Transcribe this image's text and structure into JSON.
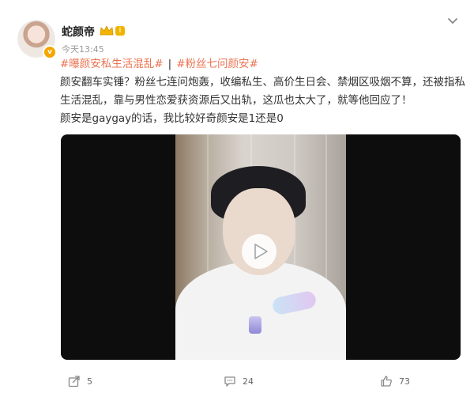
{
  "user": {
    "name": "蛇颜帝",
    "level": "I",
    "timestamp": "今天13:45",
    "avatar_badge": "v"
  },
  "post": {
    "tags": [
      "#曝颜安私生活混乱#",
      "#粉丝七问颜安#"
    ],
    "tag_separator": "|",
    "paragraph_line1": "颜安翻车实锤？粉丝七连问炮轰，收编私生、高价生日会、禁烟区吸烟不算，还被指私",
    "paragraph_line2": "生活混乱，靠与男性恋爱获资源后又出轨，这瓜也太大了，就等他回应了！",
    "paragraph_line3": "颜安是gaygay的话，我比较好奇颜安是1还是0"
  },
  "actions": {
    "share_count": "5",
    "comment_count": "24",
    "like_count": "73"
  },
  "colors": {
    "tag": "#eb7350",
    "text": "#333333",
    "muted": "#999999"
  }
}
